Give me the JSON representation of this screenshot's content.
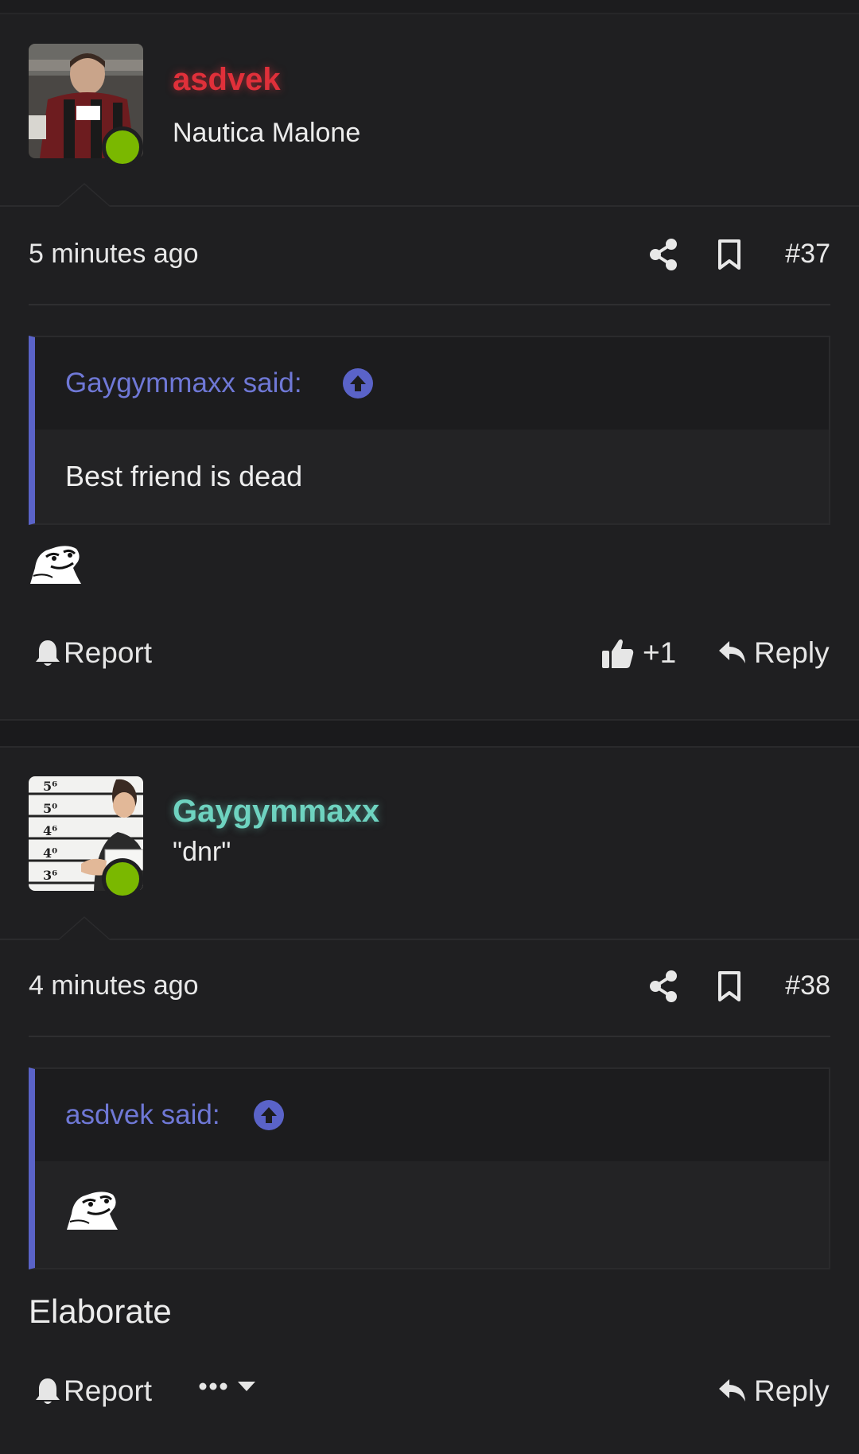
{
  "posts": [
    {
      "username": "asdvek",
      "user_title": "Nautica Malone",
      "username_color": "#e0303a",
      "time": "5 minutes ago",
      "post_number": "#37",
      "quote": {
        "author": "Gaygymmaxx said:",
        "body": "Best friend is dead"
      },
      "reaction_count": "+1",
      "report_label": "Report",
      "reply_label": "Reply"
    },
    {
      "username": "Gaygymmaxx",
      "user_title": "\"dnr\"",
      "username_color": "#6ed3c0",
      "time": "4 minutes ago",
      "post_number": "#38",
      "quote": {
        "author": "asdvek said:"
      },
      "body": "Elaborate",
      "report_label": "Report",
      "reply_label": "Reply"
    }
  ],
  "colors": {
    "online": "#7ab800",
    "quote_accent": "#5a63c8"
  }
}
